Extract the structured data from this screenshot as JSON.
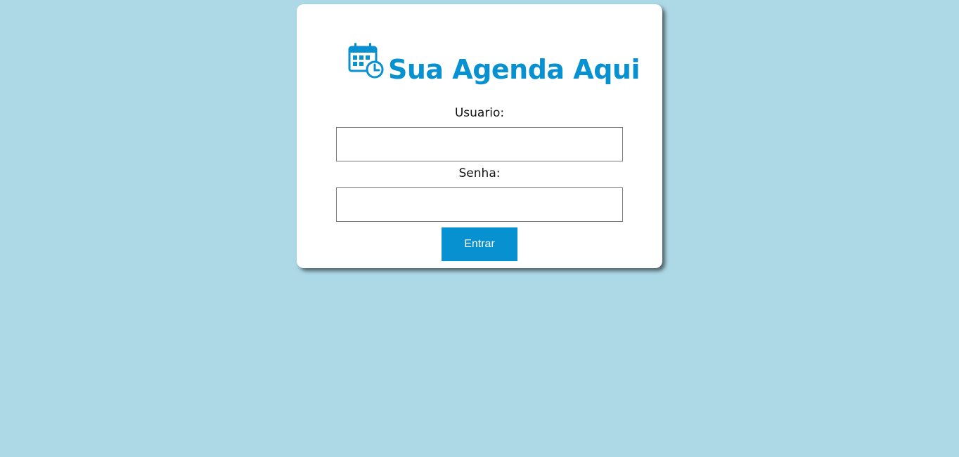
{
  "brand": {
    "title": "Sua Agenda Aqui",
    "icon": "calendar-clock-icon",
    "color": "#0791d0"
  },
  "form": {
    "user_label": "Usuario:",
    "user_value": "",
    "password_label": "Senha:",
    "password_value": "",
    "submit_label": "Entrar"
  },
  "colors": {
    "background": "#add8e6",
    "accent": "#0791d0",
    "card": "#ffffff"
  }
}
